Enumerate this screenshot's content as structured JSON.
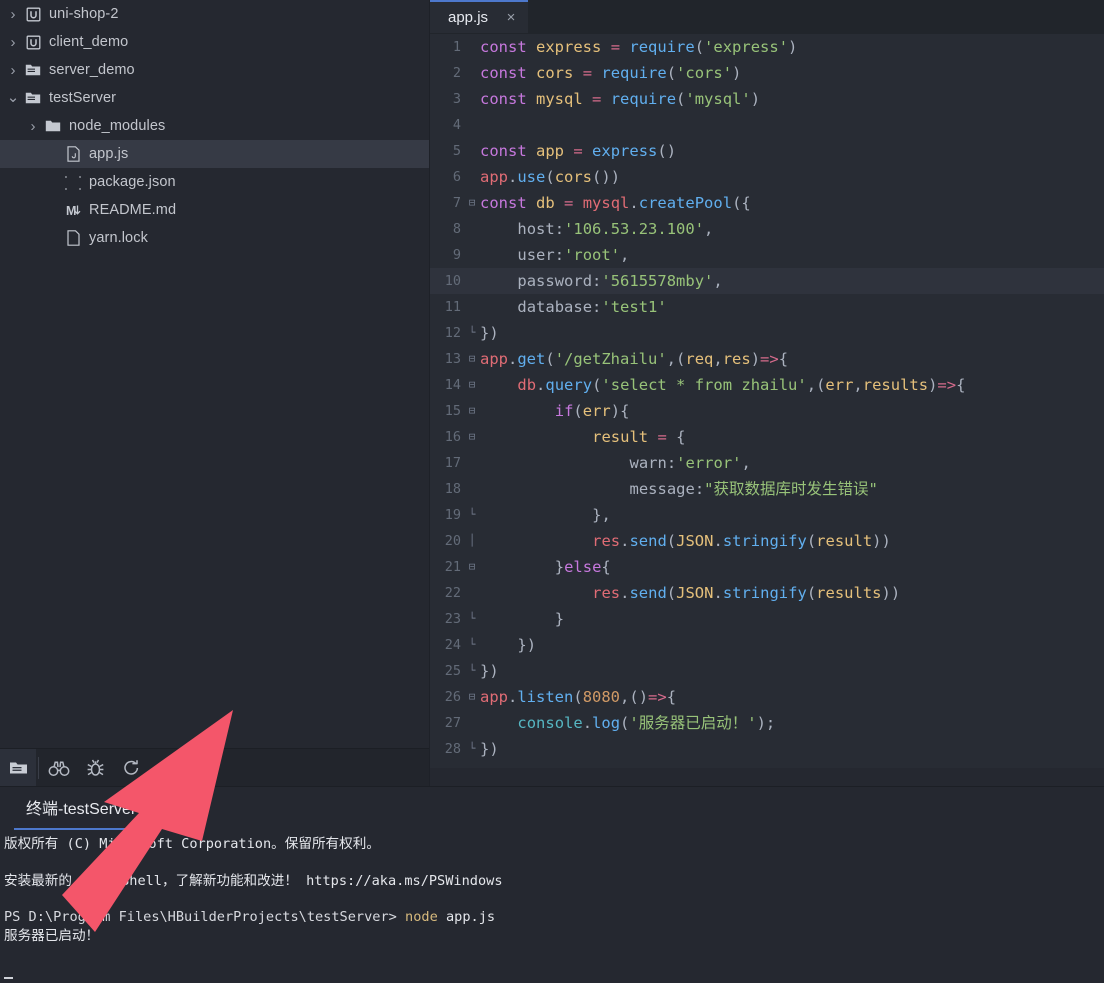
{
  "sidebar": {
    "items": [
      {
        "twisty": "chevron-right-icon",
        "icon": "uni-project-icon",
        "label": "uni-shop-2",
        "indent": 0,
        "selected": false
      },
      {
        "twisty": "chevron-right-icon",
        "icon": "uni-project-icon",
        "label": "client_demo",
        "indent": 0,
        "selected": false
      },
      {
        "twisty": "chevron-right-icon",
        "icon": "folder-open-icon",
        "label": "server_demo",
        "indent": 0,
        "selected": false
      },
      {
        "twisty": "chevron-down-icon",
        "icon": "folder-open-icon",
        "label": "testServer",
        "indent": 0,
        "selected": false
      },
      {
        "twisty": "chevron-right-icon",
        "icon": "folder-icon",
        "label": "node_modules",
        "indent": 1,
        "selected": false
      },
      {
        "twisty": "none",
        "icon": "js-file-icon",
        "label": "app.js",
        "indent": 2,
        "selected": true
      },
      {
        "twisty": "none",
        "icon": "json-file-icon",
        "label": "package.json",
        "indent": 2,
        "selected": false
      },
      {
        "twisty": "none",
        "icon": "markdown-file-icon",
        "label": "README.md",
        "indent": 2,
        "selected": false
      },
      {
        "twisty": "none",
        "icon": "plain-file-icon",
        "label": "yarn.lock",
        "indent": 2,
        "selected": false
      }
    ],
    "toolbar": [
      {
        "name": "project-explorer-icon",
        "active": true
      },
      {
        "name": "search-binoculars-icon",
        "active": false
      },
      {
        "name": "debug-bug-icon",
        "active": false
      },
      {
        "name": "run-refresh-icon",
        "active": false
      },
      {
        "name": "cloud-service-icon",
        "active": false
      }
    ]
  },
  "editor": {
    "tab": {
      "name": "app.js",
      "close": "×"
    },
    "active_line": 10,
    "lines": [
      {
        "n": "1",
        "fold": "",
        "text": "const express = require('express')"
      },
      {
        "n": "2",
        "fold": "",
        "text": "const cors = require('cors')"
      },
      {
        "n": "3",
        "fold": "",
        "text": "const mysql = require('mysql')"
      },
      {
        "n": "4",
        "fold": "",
        "text": ""
      },
      {
        "n": "5",
        "fold": "",
        "text": "const app = express()"
      },
      {
        "n": "6",
        "fold": "",
        "text": "app.use(cors())"
      },
      {
        "n": "7",
        "fold": "⊟",
        "text": "const db = mysql.createPool({"
      },
      {
        "n": "8",
        "fold": "",
        "text": "    host:'106.53.23.100',"
      },
      {
        "n": "9",
        "fold": "",
        "text": "    user:'root',"
      },
      {
        "n": "10",
        "fold": "",
        "text": "    password:'5615578mby',"
      },
      {
        "n": "11",
        "fold": "",
        "text": "    database:'test1'"
      },
      {
        "n": "12",
        "fold": "└",
        "text": "})"
      },
      {
        "n": "13",
        "fold": "⊟",
        "text": "app.get('/getZhailu',(req,res)=>{"
      },
      {
        "n": "14",
        "fold": "⊟",
        "text": "    db.query('select * from zhailu',(err,results)=>{"
      },
      {
        "n": "15",
        "fold": "⊟",
        "text": "        if(err){"
      },
      {
        "n": "16",
        "fold": "⊟",
        "text": "            result = {"
      },
      {
        "n": "17",
        "fold": "",
        "text": "                warn:'error',"
      },
      {
        "n": "18",
        "fold": "",
        "text": "                message:\"获取数据库时发生错误\""
      },
      {
        "n": "19",
        "fold": "└",
        "text": "            },"
      },
      {
        "n": "20",
        "fold": "│",
        "text": "            res.send(JSON.stringify(result))"
      },
      {
        "n": "21",
        "fold": "⊟",
        "text": "        }else{"
      },
      {
        "n": "22",
        "fold": "",
        "text": "            res.send(JSON.stringify(results))"
      },
      {
        "n": "23",
        "fold": "└",
        "text": "        }"
      },
      {
        "n": "24",
        "fold": "└",
        "text": "    })"
      },
      {
        "n": "25",
        "fold": "└",
        "text": "})"
      },
      {
        "n": "26",
        "fold": "⊟",
        "text": "app.listen(8080,()=>{"
      },
      {
        "n": "27",
        "fold": "",
        "text": "    console.log('服务器已启动！');"
      },
      {
        "n": "28",
        "fold": "└",
        "text": "})"
      }
    ]
  },
  "terminal": {
    "tab_label": "终端-testServer",
    "lines": [
      "版权所有 (C) Microsoft Corporation。保留所有权利。",
      "",
      "安装最新的 PowerShell，了解新功能和改进！ https://aka.ms/PSWindows",
      ""
    ],
    "prompt": "PS D:\\Program Files\\HBuilderProjects\\testServer> ",
    "command": "node",
    "command_arg": " app.js",
    "output": "服务器已启动！"
  },
  "annotation": {
    "arrow": "red-pointer-arrow",
    "color": "#f4566a"
  },
  "colors": {
    "sidebar_bg": "#252830",
    "editor_bg": "#282c34",
    "tabbar_bg": "#21252b",
    "selection_bg": "#363a45",
    "active_line_bg": "#2f333d",
    "accent_blue": "#4d78cc",
    "keyword": "#c678dd",
    "string": "#98c379",
    "function": "#61afef",
    "variable": "#e5c07b",
    "object": "#e06c75",
    "teal": "#56b6c2",
    "number": "#d19a66"
  }
}
